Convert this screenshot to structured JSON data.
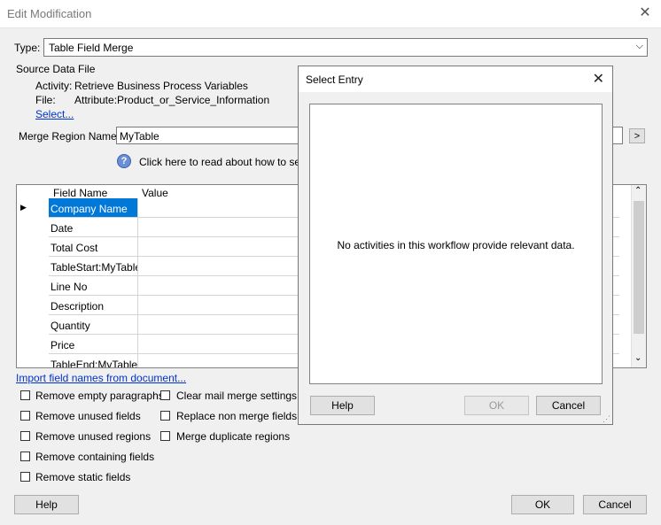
{
  "window": {
    "title": "Edit Modification"
  },
  "type_row": {
    "label": "Type:",
    "value": "Table Field Merge"
  },
  "source": {
    "heading": "Source Data File",
    "activity_label": "Activity:",
    "activity_value": "Retrieve Business Process Variables",
    "file_label": "File:",
    "file_value": "Attribute:Product_or_Service_Information",
    "select_link": "Select..."
  },
  "merge_region": {
    "label": "Merge Region Name:",
    "value": "MyTable",
    "browse": ">"
  },
  "help_text": "Click here to read about how to set up",
  "grid": {
    "headers": [
      "Field Name",
      "Value"
    ],
    "rows": [
      {
        "name": "Company Name",
        "value": ""
      },
      {
        "name": "Date",
        "value": ""
      },
      {
        "name": "Total Cost",
        "value": ""
      },
      {
        "name": "TableStart:MyTable",
        "value": ""
      },
      {
        "name": "Line No",
        "value": ""
      },
      {
        "name": "Description",
        "value": ""
      },
      {
        "name": "Quantity",
        "value": ""
      },
      {
        "name": "Price",
        "value": ""
      },
      {
        "name": "TableEnd:MyTable",
        "value": ""
      }
    ]
  },
  "import_link": "Import field names from document...",
  "options": {
    "col1": [
      "Remove empty paragraphs",
      "Remove unused fields",
      "Remove unused regions",
      "Remove containing fields",
      "Remove static fields"
    ],
    "col2": [
      "Clear mail merge settings",
      "Replace non merge fields",
      "Merge duplicate regions"
    ]
  },
  "buttons": {
    "help": "Help",
    "ok": "OK",
    "cancel": "Cancel"
  },
  "select_entry": {
    "title": "Select Entry",
    "message": "No activities in this workflow provide relevant data.",
    "help": "Help",
    "ok": "OK",
    "cancel": "Cancel"
  },
  "colors": {
    "selection": "#0078d7",
    "link": "#0033cc"
  }
}
